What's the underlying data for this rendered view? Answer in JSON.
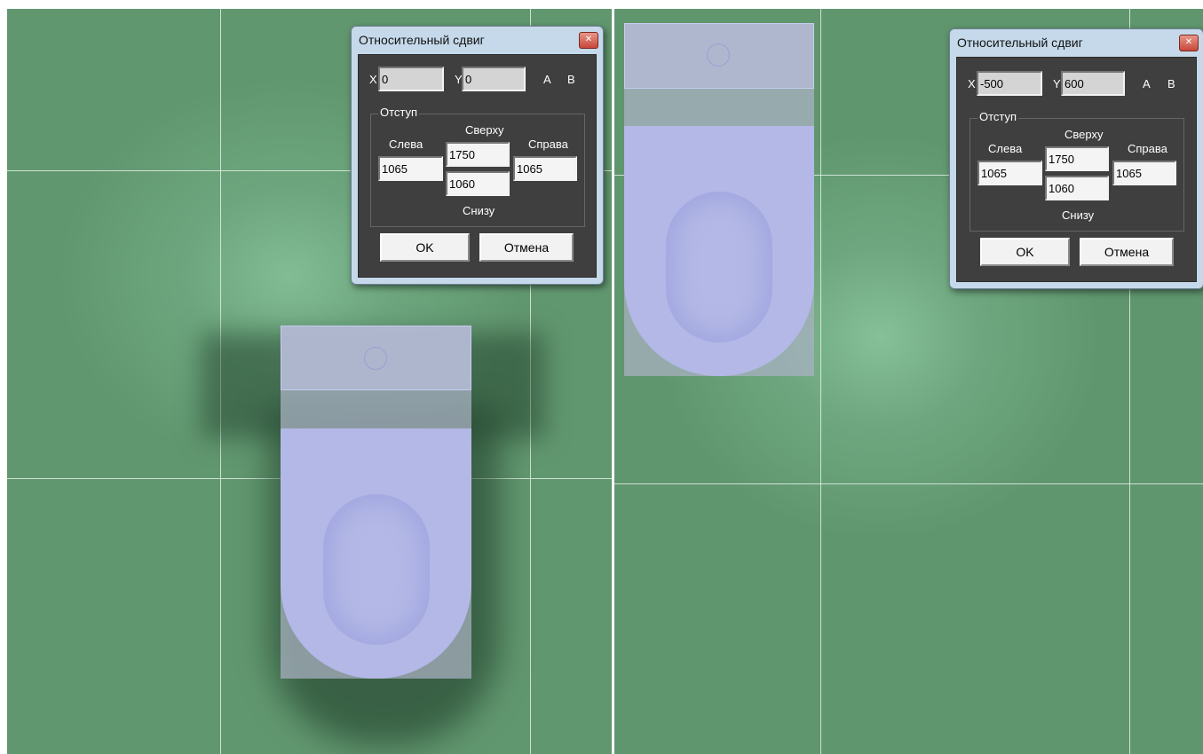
{
  "dialogs": [
    {
      "title": "Относительный сдвиг",
      "x_label": "X",
      "x_value": "0",
      "y_label": "Y",
      "y_value": "0",
      "a_label": "A",
      "b_label": "B",
      "group_caption": "Отступ",
      "left_label": "Слева",
      "left_value": "1065",
      "top_label": "Сверху",
      "top_value": "1750",
      "bottom_value": "1060",
      "bottom_label": "Снизу",
      "right_label": "Справа",
      "right_value": "1065",
      "ok_label": "OK",
      "cancel_label": "Отмена"
    },
    {
      "title": "Относительный сдвиг",
      "x_label": "X",
      "x_value": "-500",
      "y_label": "Y",
      "y_value": "600",
      "a_label": "A",
      "b_label": "B",
      "group_caption": "Отступ",
      "left_label": "Слева",
      "left_value": "1065",
      "top_label": "Сверху",
      "top_value": "1750",
      "bottom_value": "1060",
      "bottom_label": "Снизу",
      "right_label": "Справа",
      "right_value": "1065",
      "ok_label": "OK",
      "cancel_label": "Отмена"
    }
  ],
  "colors": {
    "floor_tile": "#65996f",
    "tile_highlight": "#84bd95",
    "toilet_bowl": "#b3b8e6",
    "dialog_frame": "#c5d9ea",
    "dialog_body": "#3f3f3f",
    "close_button": "#c8483a"
  },
  "icons": {
    "close": "close-icon"
  }
}
